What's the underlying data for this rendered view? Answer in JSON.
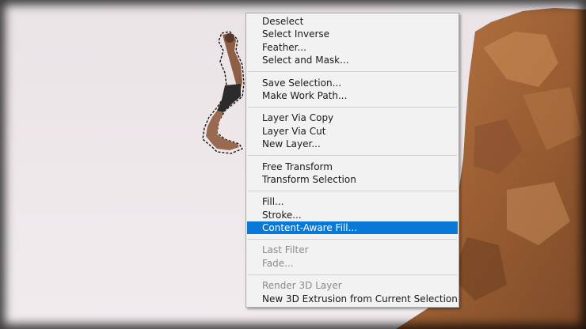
{
  "menu": {
    "groups": [
      [
        {
          "label": "Deselect",
          "enabled": true
        },
        {
          "label": "Select Inverse",
          "enabled": true
        },
        {
          "label": "Feather...",
          "enabled": true
        },
        {
          "label": "Select and Mask...",
          "enabled": true
        }
      ],
      [
        {
          "label": "Save Selection...",
          "enabled": true
        },
        {
          "label": "Make Work Path...",
          "enabled": true
        }
      ],
      [
        {
          "label": "Layer Via Copy",
          "enabled": true
        },
        {
          "label": "Layer Via Cut",
          "enabled": true
        },
        {
          "label": "New Layer...",
          "enabled": true
        }
      ],
      [
        {
          "label": "Free Transform",
          "enabled": true
        },
        {
          "label": "Transform Selection",
          "enabled": true
        }
      ],
      [
        {
          "label": "Fill...",
          "enabled": true
        },
        {
          "label": "Stroke...",
          "enabled": true
        },
        {
          "label": "Content-Aware Fill...",
          "enabled": true,
          "highlighted": true
        }
      ],
      [
        {
          "label": "Last Filter",
          "enabled": false
        },
        {
          "label": "Fade...",
          "enabled": false
        }
      ],
      [
        {
          "label": "Render 3D Layer",
          "enabled": false
        },
        {
          "label": "New 3D Extrusion from Current Selection",
          "enabled": true
        }
      ]
    ]
  },
  "colors": {
    "highlight": "#0a78d7",
    "rock": "#a8683a",
    "sky": "#ece6e9"
  }
}
